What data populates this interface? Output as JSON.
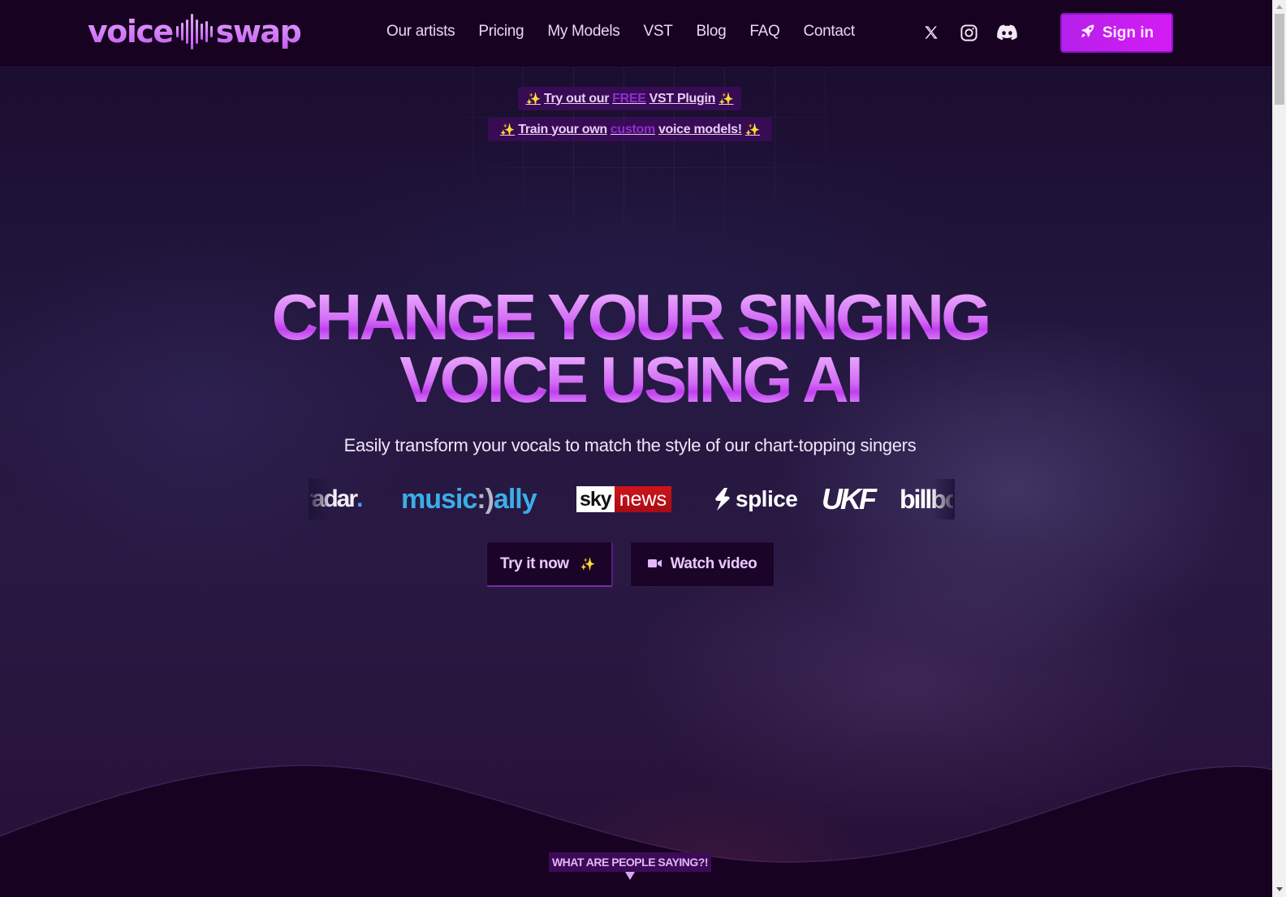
{
  "brand": {
    "left": "voice",
    "right": "swap",
    "accent": "#c35cf0"
  },
  "nav": {
    "items": [
      "Our artists",
      "Pricing",
      "My Models",
      "VST",
      "Blog",
      "FAQ",
      "Contact"
    ]
  },
  "social": [
    {
      "icon": "x-twitter-icon",
      "glyph": "𝕏"
    },
    {
      "icon": "instagram-icon"
    },
    {
      "icon": "discord-icon"
    }
  ],
  "signin": {
    "label": "Sign in",
    "icon": "rocket-icon",
    "color": "#d41cf4"
  },
  "promos": [
    {
      "prefix": "Try out our",
      "highlight": "FREE",
      "suffix": "VST Plugin",
      "spark": "✨"
    },
    {
      "prefix": "Train your own",
      "highlight": "custom",
      "suffix": "voice models!",
      "spark": "✨"
    }
  ],
  "hero": {
    "headline_line1": "CHANGE YOUR SINGING",
    "headline_line2": "VOICE USING AI",
    "subtitle": "Easily transform your vocals to match the style of our chart-topping singers"
  },
  "press": {
    "radar": "radar",
    "radar_dot": ".",
    "musically_a": "music",
    "musically_smile": ":)",
    "musically_b": "ally",
    "sky": "sky",
    "news": "news",
    "splice": "splice",
    "ukf": "UKF",
    "billboard": "billboard"
  },
  "cta": {
    "try_label": "Try it now",
    "try_spark": "✨",
    "watch_label": "Watch video"
  },
  "testimonials_teaser": "WHAT ARE PEOPLE SAYING?!"
}
